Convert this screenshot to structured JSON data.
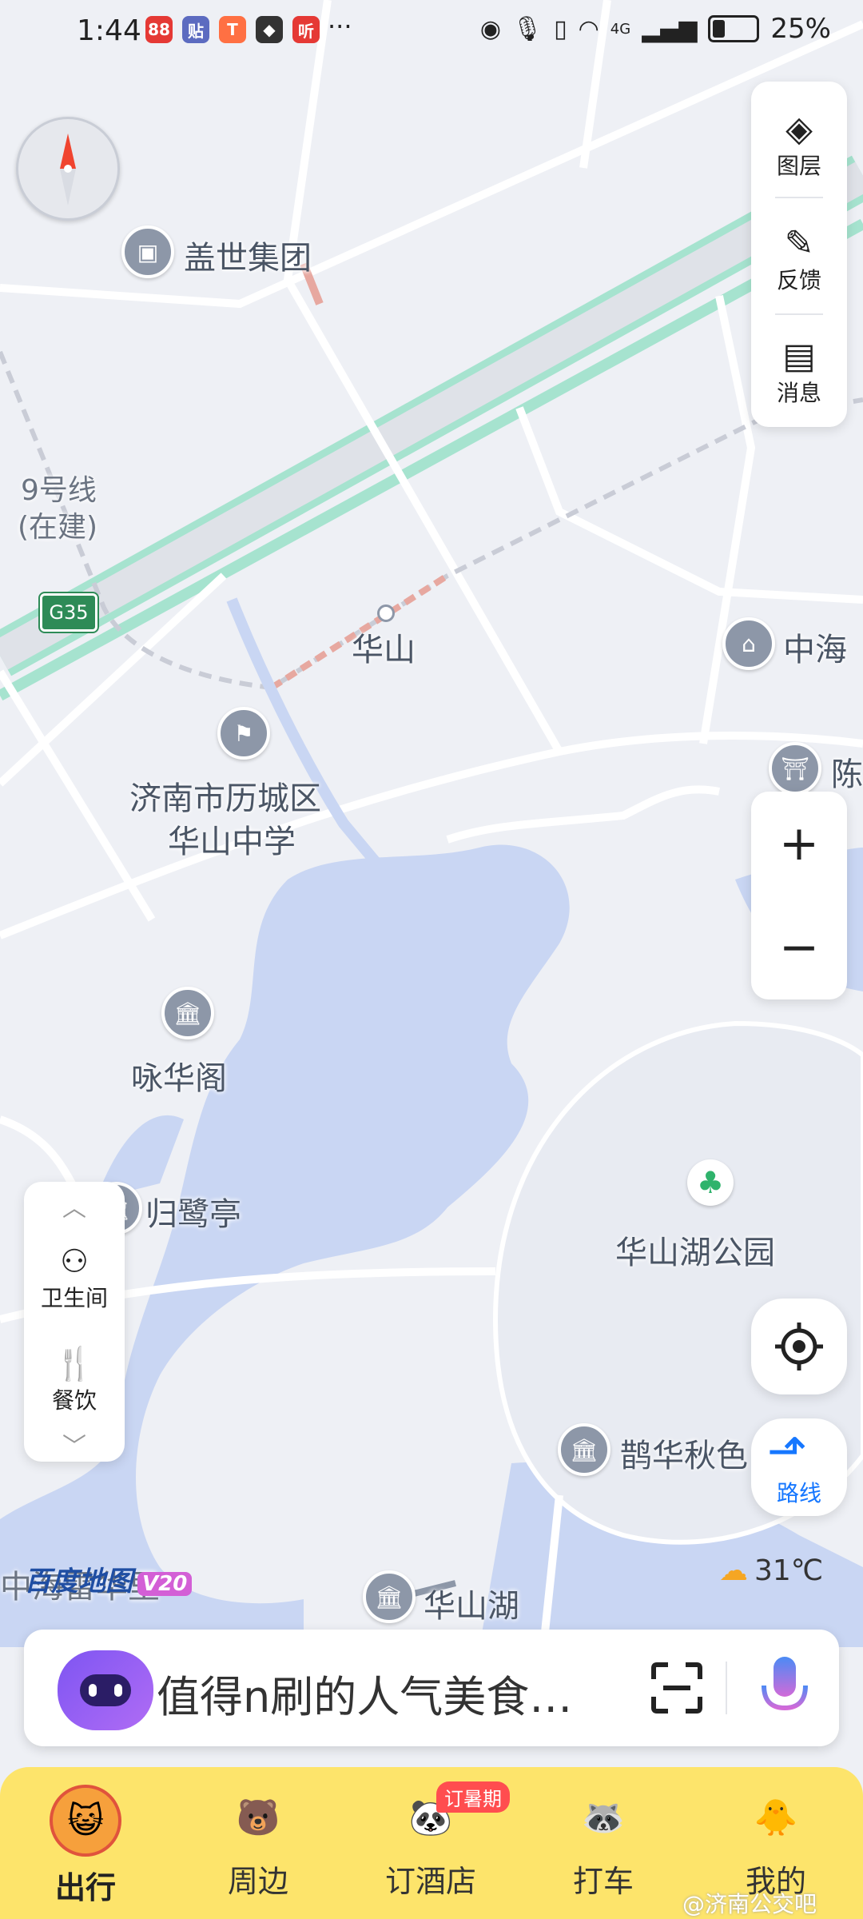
{
  "status_bar": {
    "time": "1:44",
    "more": "···",
    "network": "4G",
    "battery": "25%",
    "apps": [
      {
        "name": "app-icon-1",
        "text": "88",
        "color": "#e53935"
      },
      {
        "name": "app-icon-2",
        "text": "贴",
        "color": "#5c6bc0"
      },
      {
        "name": "app-icon-3",
        "text": "T",
        "color": "#ff7043"
      },
      {
        "name": "qq-icon",
        "text": "◆",
        "color": "#333333"
      },
      {
        "name": "app-icon-5",
        "text": "听",
        "color": "#e53935"
      }
    ]
  },
  "map": {
    "labels": {
      "gaishi": "盖世集团",
      "line9": "9号线",
      "line9_sub": "(在建)",
      "g35": "G35",
      "huashan": "华山",
      "zhonghai": "中海",
      "chen": "陈",
      "school_line1": "济南市历城区",
      "school_line2": "华山中学",
      "yonghuage": "咏华阁",
      "guilu": "归鹭亭",
      "park": "华山湖公园",
      "quehua": "鹊华秋色",
      "lake": "华山湖",
      "zhongwan": "中海雷华里"
    },
    "temperature": "31℃",
    "brand": "百度地图",
    "version": "V20"
  },
  "right_toolbar": {
    "layers": "图层",
    "feedback": "反馈",
    "messages": "消息"
  },
  "zoom": {
    "in": "+",
    "out": "−"
  },
  "route_label": "路线",
  "left_panel": {
    "toilet": "卫生间",
    "dining": "餐饮"
  },
  "search": {
    "placeholder": "值得n刷的人气美食…"
  },
  "bottom_nav": [
    {
      "label": "出行",
      "icon": "😺"
    },
    {
      "label": "周边",
      "icon": "🐻"
    },
    {
      "label": "订酒店",
      "icon": "🐼",
      "badge": "订暑期"
    },
    {
      "label": "打车",
      "icon": "🦝"
    },
    {
      "label": "我的",
      "icon": "🐥"
    }
  ],
  "watermark": "@济南公交吧",
  "colors": {
    "accent": "#1677ff",
    "nav_bg": "#fde46b",
    "water": "#c9d6f3",
    "road_green": "#a6e3cf"
  }
}
